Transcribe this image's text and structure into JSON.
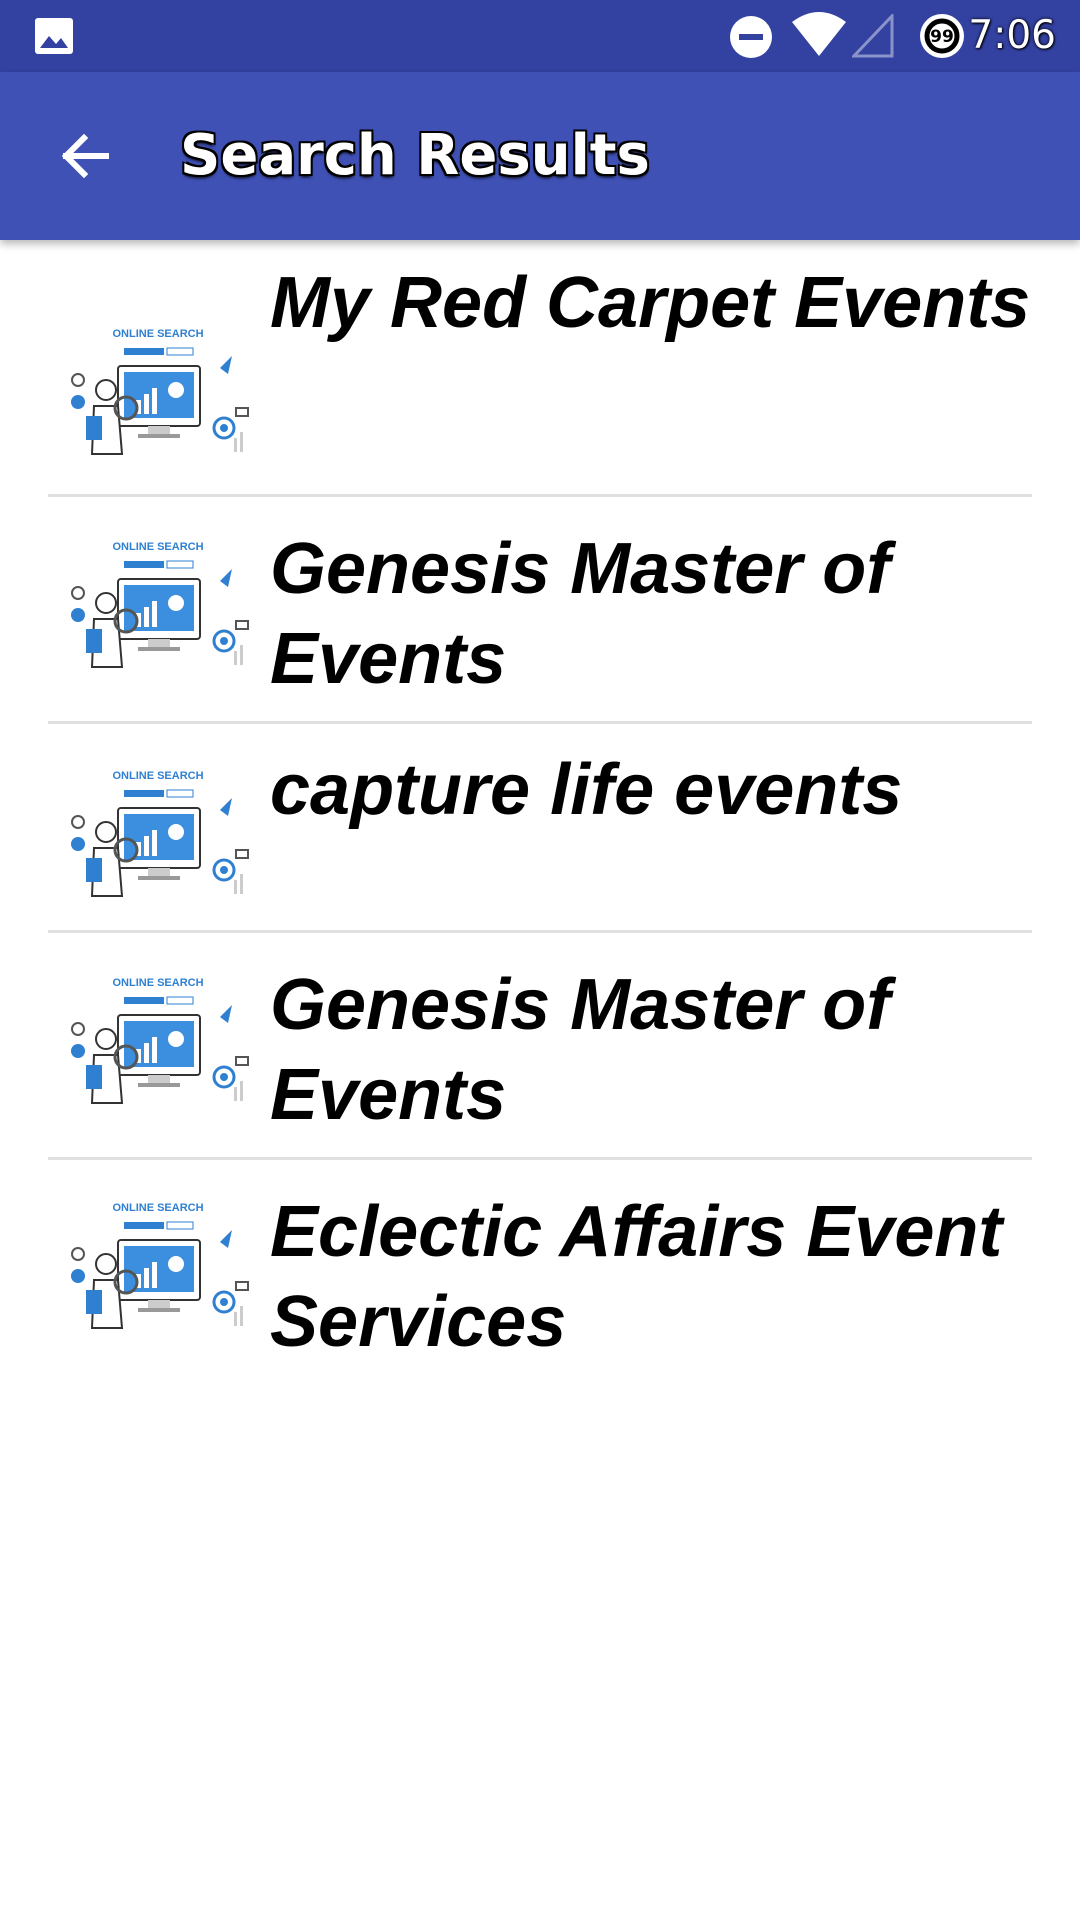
{
  "status_bar": {
    "time": "7:06",
    "battery_level": "99",
    "icons": [
      "gallery-icon",
      "do-not-disturb-icon",
      "wifi-icon",
      "cellular-signal-icon",
      "battery-icon"
    ]
  },
  "app_bar": {
    "title": "Search Results",
    "back_icon": "arrow-back-icon"
  },
  "colors": {
    "status_bar": "#3341a1",
    "app_bar": "#3f51b5",
    "background": "#ffffff",
    "divider": "#e0e0e0",
    "thumbnail_accent": "#2f80d1"
  },
  "results": [
    {
      "title": "My Red Carpet Events",
      "thumb_caption": "ONLINE SEARCH"
    },
    {
      "title": "Genesis Master of Events",
      "thumb_caption": "ONLINE SEARCH"
    },
    {
      "title": "capture life events",
      "thumb_caption": "ONLINE SEARCH"
    },
    {
      "title": "Genesis Master of Events",
      "thumb_caption": "ONLINE SEARCH"
    },
    {
      "title": "Eclectic Affairs Event Services",
      "thumb_caption": "ONLINE SEARCH"
    }
  ]
}
